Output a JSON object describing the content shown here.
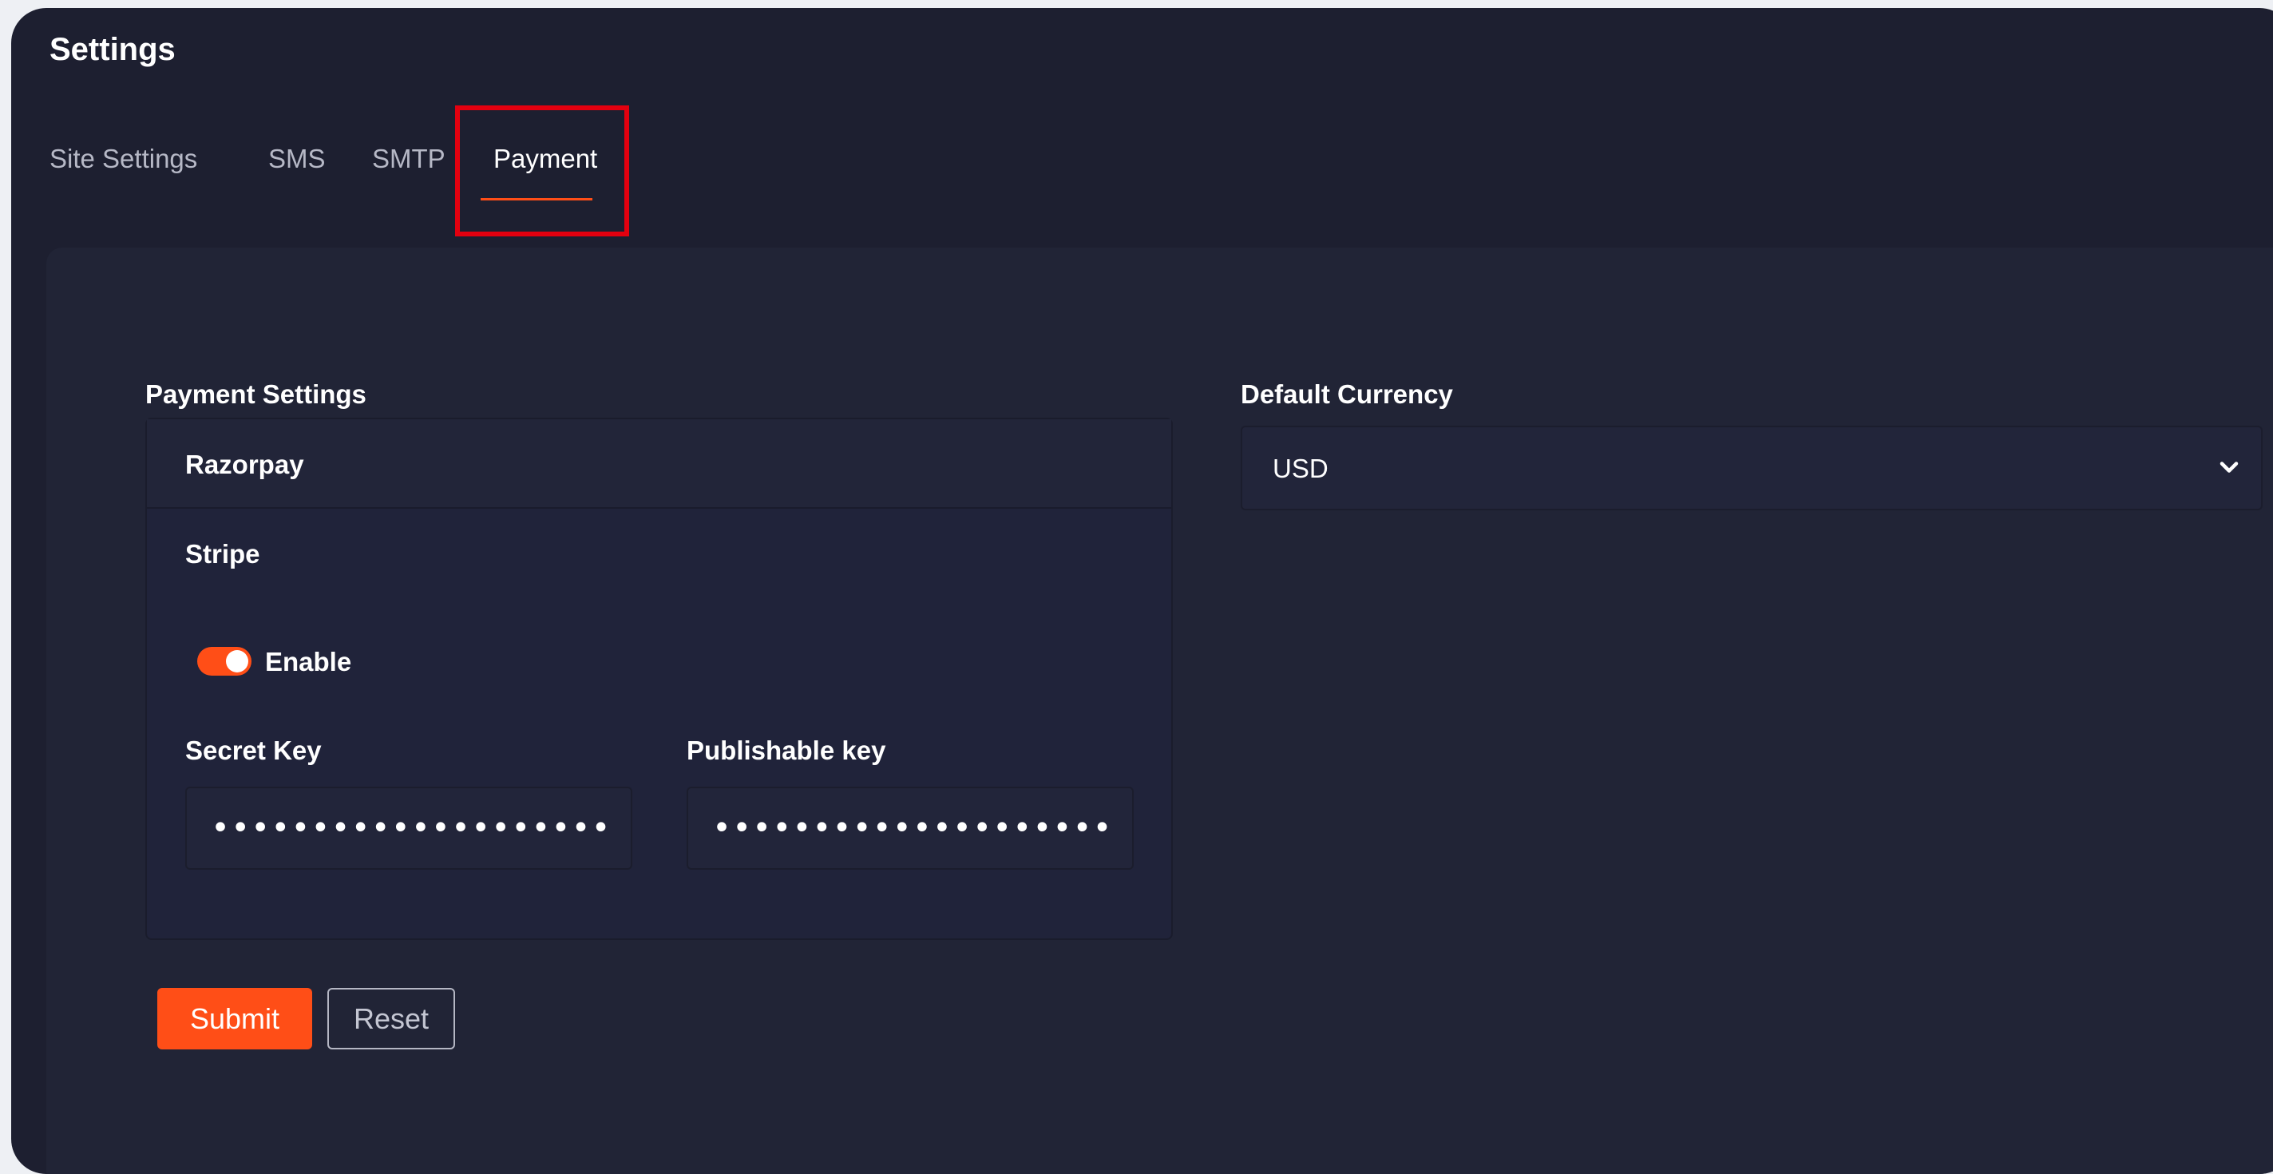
{
  "page": {
    "title": "Settings"
  },
  "tabs": [
    {
      "label": "Site Settings"
    },
    {
      "label": "SMS"
    },
    {
      "label": "SMTP"
    },
    {
      "label": "Payment",
      "active": true
    }
  ],
  "payment_settings": {
    "label": "Payment Settings",
    "providers": [
      {
        "name": "Razorpay",
        "expanded": false
      },
      {
        "name": "Stripe",
        "expanded": true,
        "enable_label": "Enable",
        "enabled": true,
        "secret_key_label": "Secret Key",
        "secret_key_value": "••••••••••••••••••••••••••••",
        "publishable_key_label": "Publishable key",
        "publishable_key_value": "••••••••••••••••••••••••••••"
      }
    ]
  },
  "default_currency": {
    "label": "Default Currency",
    "selected": "USD",
    "icon": "chevron-down-icon"
  },
  "actions": {
    "submit_label": "Submit",
    "reset_label": "Reset"
  },
  "colors": {
    "accent": "#ff4e17",
    "background": "#1d1f30",
    "panel": "#212436",
    "highlight": "#e3000f"
  }
}
